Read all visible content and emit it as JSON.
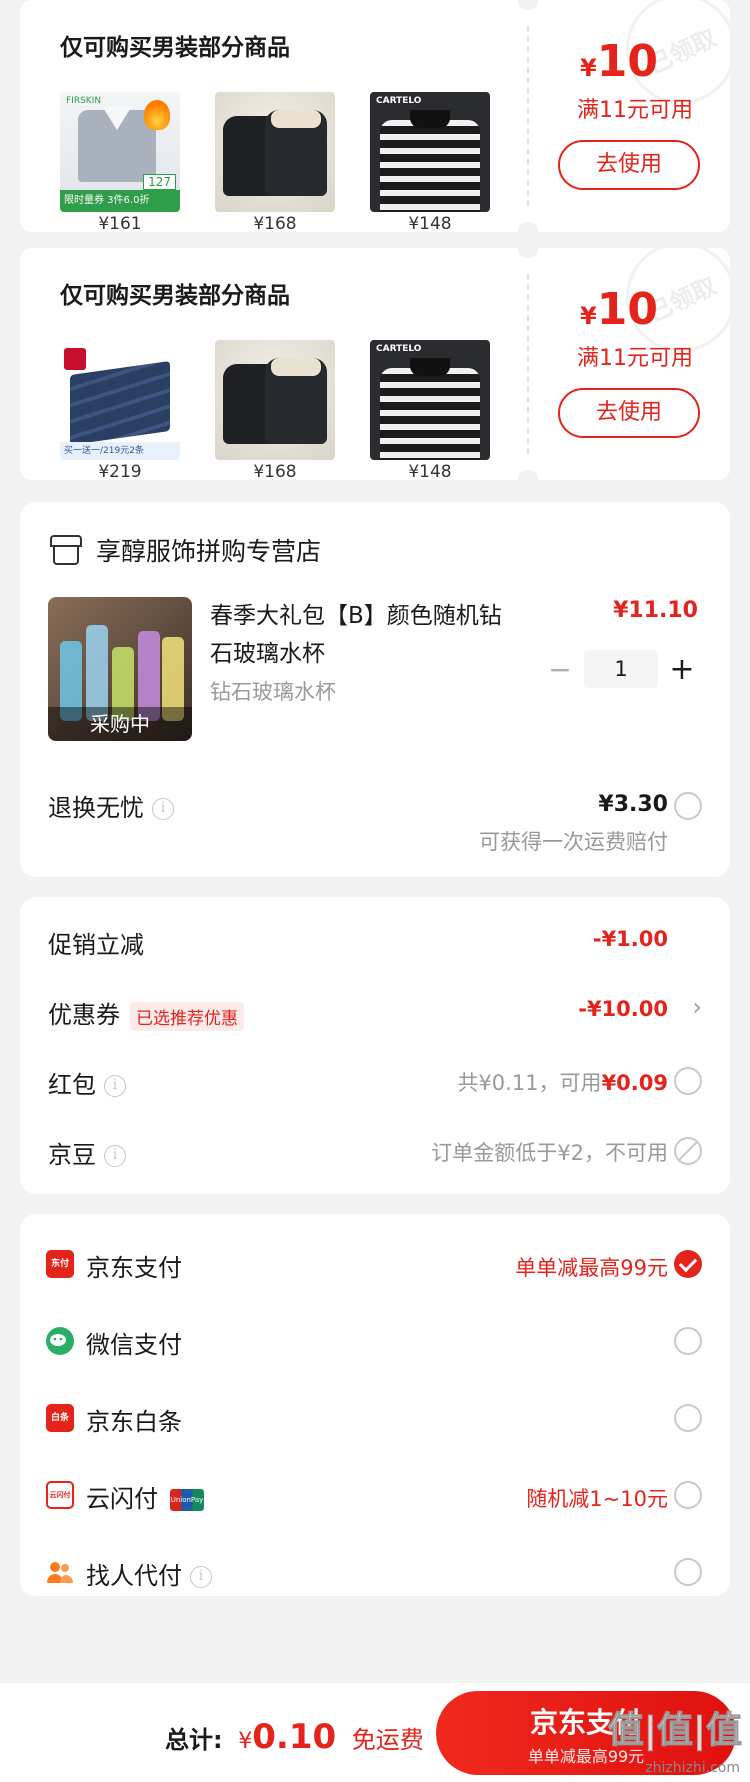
{
  "coupons": [
    {
      "title": "仅可购买男装部分商品",
      "currency": "¥",
      "amount": "10",
      "condition": "满11元可用",
      "button": "去使用",
      "stamp": "已领取",
      "products": [
        {
          "price": "¥161",
          "brand": "FIRSKIN",
          "promo": "限时量券 3件6.0折",
          "tag": "127"
        },
        {
          "price": "¥168"
        },
        {
          "price": "¥148",
          "brand": "CARTELO"
        }
      ]
    },
    {
      "title": "仅可购买男装部分商品",
      "currency": "¥",
      "amount": "10",
      "condition": "满11元可用",
      "button": "去使用",
      "stamp": "已领取",
      "products": [
        {
          "price": "¥219",
          "promo": "买一送一/219元2条"
        },
        {
          "price": "¥168"
        },
        {
          "price": "¥148",
          "brand": "CARTELO"
        }
      ]
    }
  ],
  "shop": {
    "name": "享醇服饰拼购专营店",
    "item": {
      "title": "春季大礼包【B】颜色随机钻石玻璃水杯",
      "spec": "钻石玻璃水杯",
      "price": "¥11.10",
      "status": "采购中",
      "quantity": "1",
      "minus": "−",
      "plus": "+"
    },
    "return_service": {
      "label": "退换无忧",
      "price": "¥3.30",
      "desc": "可获得一次运费赔付"
    }
  },
  "discounts": {
    "promo": {
      "label": "促销立减",
      "value": "-¥1.00"
    },
    "coupon": {
      "label": "优惠券",
      "tag": "已选推荐优惠",
      "value": "-¥10.00"
    },
    "redpack": {
      "label": "红包",
      "value_prefix": "共¥0.11，可用",
      "value_hl": "¥0.09"
    },
    "jingdou": {
      "label": "京豆",
      "value": "订单金额低于¥2，不可用"
    }
  },
  "payment": [
    {
      "label": "京东支付",
      "note": "单单减最高99元",
      "icon": "jd-pay-icon",
      "icon_text": "东付",
      "color": "#e4231b",
      "checked": true
    },
    {
      "label": "微信支付",
      "note": "",
      "icon": "wechat-pay-icon",
      "color": "#2aae67"
    },
    {
      "label": "京东白条",
      "note": "",
      "icon": "jd-baitiao-icon",
      "icon_text": "白条",
      "color": "#e4231b"
    },
    {
      "label": "云闪付",
      "note": "随机减1~10元",
      "icon": "quickpass-icon",
      "icon_text": "云闪付",
      "color": "#e4231b",
      "badge": "UnionPay"
    },
    {
      "label": "找人代付",
      "note": "",
      "icon": "friends-pay-icon",
      "color": "#ff7a1a"
    }
  ],
  "footer": {
    "total_label": "总计:",
    "currency": "¥",
    "total": "0.10",
    "shipping": "免运费",
    "pay_button": "京东支付",
    "pay_sub": "单单减最高99元",
    "watermark": "值|值|值",
    "watermark_url": "zhizhizhi.com"
  },
  "info_icon": "i"
}
